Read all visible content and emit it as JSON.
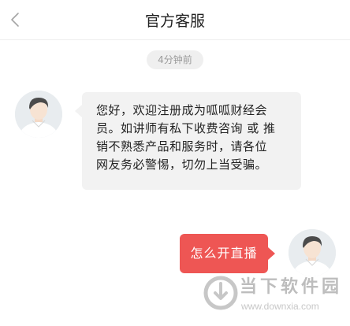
{
  "header": {
    "title": "官方客服",
    "back_icon": "chevron-left-icon"
  },
  "chat": {
    "timestamp": "4分钟前",
    "incoming": {
      "lines": [
        "您好，欢迎注册成为呱呱财经会",
        "员。如讲师有私下收费咨询 或 推",
        "销不熟悉产品和服务时，请各位",
        "网友务必警惕，切勿上当受骗。"
      ],
      "avatar_icon": "user-avatar-icon"
    },
    "outgoing": {
      "text": "怎么开直播",
      "avatar_icon": "user-avatar-icon"
    }
  },
  "watermark": {
    "name": "当下软件园",
    "url": "www.downxia.com"
  },
  "colors": {
    "outgoing_bubble": "#ee5654",
    "incoming_bubble": "#f2f2f2",
    "timestamp_bg": "#efefef"
  }
}
